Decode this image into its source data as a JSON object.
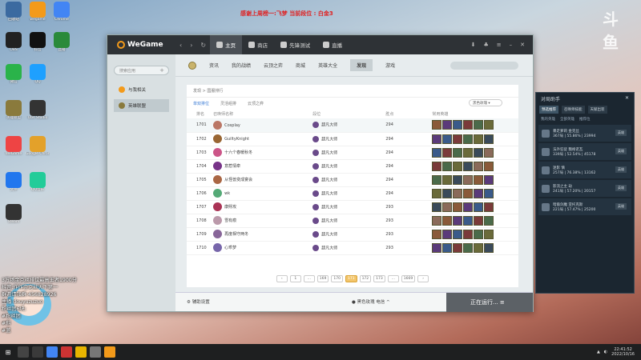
{
  "overlay": {
    "banner": "感谢上周榜一:飞梦 当前段位 : 白金3",
    "corner_logo": "斗鱼"
  },
  "desktop": {
    "icons": [
      "回收站",
      "wegame",
      "Chrome",
      "OBS",
      "抖音",
      "直播",
      "微信",
      "QQ",
      "英雄联盟",
      "Obs Studio",
      "Google Chrome",
      "WeGame",
      "文件",
      "QQ音乐",
      "Steam"
    ]
  },
  "window": {
    "brand": "WeGame",
    "tabs": [
      {
        "label": "主页",
        "active": true
      },
      {
        "label": "商店"
      },
      {
        "label": "先锋测试"
      },
      {
        "label": "直播"
      }
    ],
    "sidebar": {
      "search_placeholder": "搜索应用",
      "items": [
        {
          "label": "与我相关"
        },
        {
          "label": "英雄联盟",
          "active": true
        }
      ]
    },
    "subnav": [
      "资讯",
      "我的战绩",
      "云顶之弈",
      "商城",
      "英雄大全",
      "发现",
      "游戏"
    ],
    "subnav_active": "发现",
    "breadcrumb": "发现 > 国服排行",
    "filters": [
      "单双排位",
      "灵活组排",
      "云顶之弈"
    ],
    "server_select": "黑色玫瑰",
    "table": {
      "headers": [
        "排名",
        "召唤师名称",
        "段位",
        "胜点",
        "常用英雄"
      ],
      "rows": [
        {
          "rank": "1701",
          "name": "Cosplay",
          "tier": "超凡大师",
          "lp": "294"
        },
        {
          "rank": "1702",
          "name": "GuiltyKnight",
          "tier": "超凡大师",
          "lp": "294"
        },
        {
          "rank": "1703",
          "name": "十六个春暖秋冬",
          "tier": "超凡大师",
          "lp": "294"
        },
        {
          "rank": "1704",
          "name": "意惹情牵",
          "tier": "超凡大师",
          "lp": "294"
        },
        {
          "rank": "1705",
          "name": "从怪兽变成宴会",
          "tier": "超凡大师",
          "lp": "294"
        },
        {
          "rank": "1706",
          "name": "wk",
          "tier": "超凡大师",
          "lp": "294"
        },
        {
          "rank": "1707",
          "name": "康熙攻",
          "tier": "超凡大师",
          "lp": "293"
        },
        {
          "rank": "1708",
          "name": "雪有痕",
          "tier": "超凡大师",
          "lp": "293"
        },
        {
          "rank": "1709",
          "name": "再度相守两冬",
          "tier": "超凡大师",
          "lp": "293"
        },
        {
          "rank": "1710",
          "name": "心乖梦",
          "tier": "超凡大师",
          "lp": "293"
        }
      ]
    },
    "pager": [
      "‹",
      "1",
      "…",
      "169",
      "170",
      "171",
      "172",
      "173",
      "…",
      "1669",
      "›"
    ],
    "pager_current": "171",
    "bottom": {
      "settings": "辅助设置",
      "game": "黑色玫瑰 电信",
      "running": "正在运行..."
    }
  },
  "right_panel": {
    "title": "对局助手",
    "tabs": [
      "预选推荐",
      "召唤师技能",
      "天赋出装"
    ],
    "subtabs": [
      "我的英雄",
      "全部英雄",
      "推荐位"
    ],
    "items": [
      {
        "name": "暴走萝莉 金克丝",
        "stats": "367局 | 55.86% | 23994",
        "btn": "英雄"
      },
      {
        "name": "法外狂徒 魏格诺瓦",
        "stats": "339局 | 52.54% | 45178",
        "btn": "英雄"
      },
      {
        "name": "迷影 慎",
        "stats": "257局 | 76.38% | 13162",
        "btn": "英雄"
      },
      {
        "name": "影流之主 劫",
        "stats": "241局 | 57.20% | 20157",
        "btn": "英雄"
      },
      {
        "name": "暗裔剑魔 亚托克斯",
        "stats": "221局 | 57.47% | 25200",
        "btn": "英雄"
      }
    ]
  },
  "stream_text": [
    "3万场金克丝排位最高王者1900分",
    "抖音:作作金克丝天下第一",
    "群邀请加群:456828926",
    "主播 douyuzuzuo",
    "粉丝团6块:",
    "#粉丝团",
    "#斜",
    "#蓝"
  ],
  "taskbar": {
    "time": "22:41:52",
    "date": "2022/10/16"
  }
}
